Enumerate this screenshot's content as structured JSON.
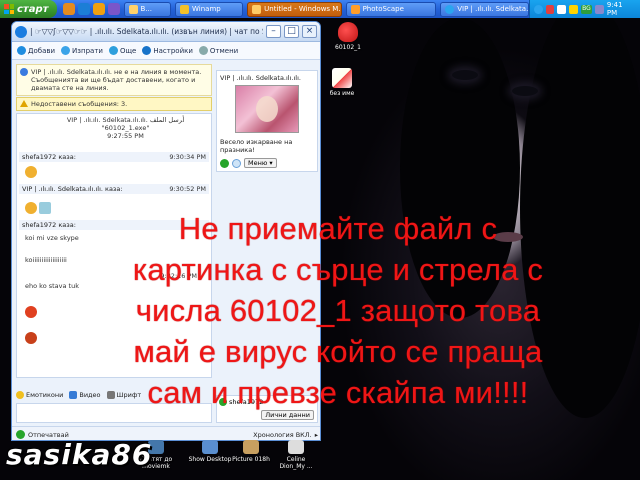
{
  "taskbar": {
    "start_label": "старт",
    "buttons": [
      {
        "label": "В..."
      },
      {
        "label": "Winamp"
      },
      {
        "label": "Untitled - Windows M..."
      },
      {
        "label": "PhotoScape"
      },
      {
        "label": "VIP | .ılı.ılı. Sdelkata.ılı.ılı."
      }
    ],
    "tray_lang": "BG",
    "clock": "9:41 PM"
  },
  "desktop_icons": [
    {
      "label": "60102_1"
    },
    {
      "label": "без име"
    },
    {
      "label": "Пратят до moviemk"
    },
    {
      "label": "Show Desktop"
    },
    {
      "label": "Picture 018h"
    },
    {
      "label": "Celine Dion_My ..."
    }
  ],
  "chat_window": {
    "title": "| ☞▽▽ʃ☞▽▽☞☞ | .ılı.ılı. Sdelkata.ılı.ılı. (извън линия) | чат по S...",
    "toolbar": {
      "add": "Добави",
      "send": "Изпрати",
      "more": "Още",
      "settings": "Настройки",
      "reply": "Отмени"
    },
    "notice": "VIP | .ılı.ılı. Sdelkata.ılı.ılı. не е на линия в момента. Съобщенията ви ще бъдат доставени, когато и двамата сте на линия.",
    "warning": "Недоставени съобщения: 3.",
    "messages": [
      {
        "sender": "VIP | .ılı.ılı. Sdelkata.ılı.ılı. ﺃﺮﺳﻞ ﺍﻟﻤﻠﻒ",
        "text": "\"60102_1.exe\"",
        "time": "9:27:55 PM"
      },
      {
        "sender": "shefa1972 каза:",
        "time": "9:30:34 PM"
      },
      {
        "sender": "VIP | .ılı.ılı. Sdelkata.ılı.ılı. каза:",
        "time": "9:30:52 PM"
      },
      {
        "sender": "shefa1972 каза:",
        "text": "koi mi vze skype"
      },
      {
        "text": "koiiiiiiiiiiiiiiiiiii"
      },
      {
        "text": "eho ko stava tuk",
        "time": "9:32:16 PM"
      }
    ],
    "bottom_bar": {
      "emoticons": "Емотикони",
      "video": "Видео",
      "font": "Шрифт"
    },
    "status": "Отпечатвай",
    "history": "Хронология ВКЛ.",
    "contact_card": {
      "name": "VIP | .ılı.ılı. Sdelkata.ılı.ılı.",
      "greeting": "Весело изкарване на празника!",
      "menu": "Меню"
    },
    "self_card": {
      "name": "shefa1972",
      "button": "Лични данни"
    }
  },
  "overlay_text": {
    "line1": "Не приемайте файл с",
    "line2": "картинка с сърце и стрела с",
    "line3": "числа 60102_1 защото това",
    "line4": "май е вирус който се праща",
    "line5": "сам и  превзе скайпа ми!!!!"
  },
  "watermark": "sasika86",
  "colors": {
    "overlay_red": "#ef1616",
    "taskbar_blue": "#2462d8",
    "start_green": "#37952e"
  }
}
